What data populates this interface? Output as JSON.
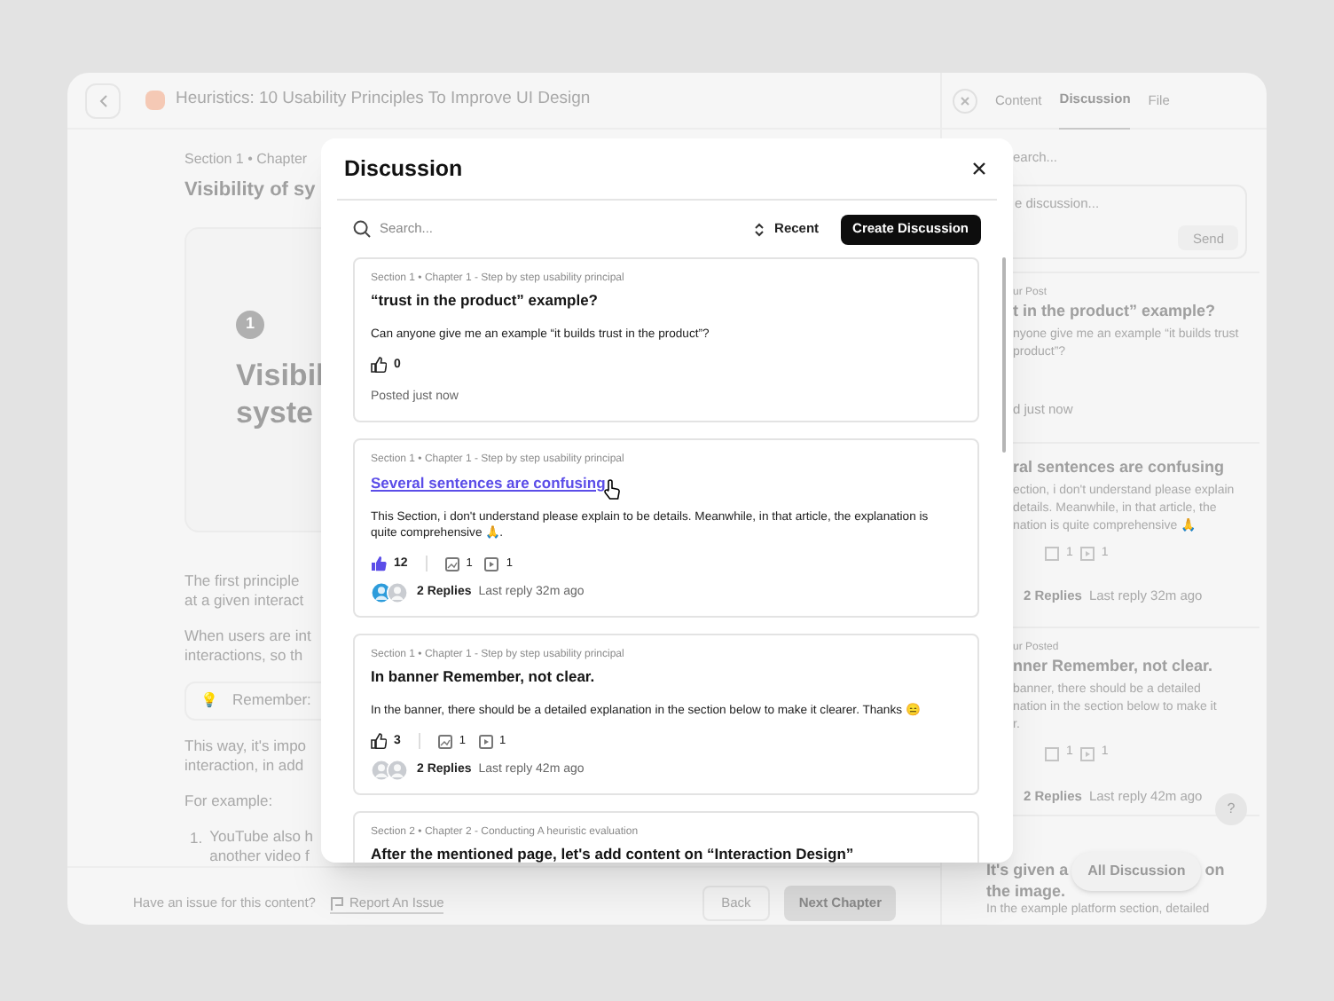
{
  "app": {
    "title": "Heuristics: 10 Usability Principles To Improve UI Design"
  },
  "lesson": {
    "breadcrumb": "Section 1 • Chapter",
    "heading": "Visibility of sy",
    "card_number": "1",
    "card_title_lines": [
      "Visibil",
      "syste"
    ],
    "paragraphs": [
      [
        "The first principle",
        "at a given interact"
      ],
      [
        "When users are int",
        "interactions, so th"
      ]
    ],
    "banner": {
      "emoji": "💡",
      "text": "Remember:"
    },
    "paragraphs_after": [
      [
        "This way, it's impo",
        "interaction, in add"
      ],
      [
        "For example:"
      ]
    ],
    "list": [
      {
        "number": "1.",
        "lines": [
          "YouTube also h",
          "another video f"
        ]
      }
    ]
  },
  "footer": {
    "question": "Have an issue for this content?",
    "report": "Report An Issue",
    "back": "Back",
    "next": "Next Chapter"
  },
  "sidebar": {
    "tabs": [
      {
        "label": "Content",
        "selected": false
      },
      {
        "label": "Discussion",
        "selected": true
      },
      {
        "label": "File",
        "selected": false
      }
    ],
    "search_placeholder": "earch...",
    "compose_placeholder": "e discussion...",
    "send": "Send",
    "posts": [
      {
        "meta": "ur Post",
        "title": "t in the product” example?",
        "body": [
          "nyone give me an example “it builds trust",
          "product”?"
        ],
        "posted": "d just now"
      },
      {
        "title": "ral sentences are confusing",
        "body": [
          "ection, i don't understand please explain",
          "details. Meanwhile, in that article, the",
          "nation is quite comprehensive 🙏"
        ],
        "images": "1",
        "videos": "1",
        "replies": "2 Replies",
        "last_reply": "Last reply 32m ago"
      },
      {
        "meta": "ur Posted",
        "title": "nner Remember, not clear.",
        "body": [
          "banner, there should be a detailed",
          "nation in the section below to make it",
          "r."
        ],
        "images": "1",
        "videos": "1",
        "replies": "2 Replies",
        "last_reply": "Last reply 42m ago"
      }
    ],
    "bottom_title": [
      "It's given a",
      "on",
      "the image."
    ],
    "bottom_text": "In the example platform section, detailed",
    "all_button": "All Discussion",
    "help": "?"
  },
  "modal": {
    "title": "Discussion",
    "search_placeholder": "Search...",
    "sort": "Recent",
    "create": "Create Discussion",
    "threads": [
      {
        "meta": "Section 1 • Chapter 1 - Step by step usability principal",
        "title": "“trust in the product” example?",
        "hovered": false,
        "body": "Can anyone give me an example “it builds trust in the product”?",
        "liked": false,
        "likes": "0",
        "posted": "Posted just now"
      },
      {
        "meta": "Section 1 • Chapter 1 - Step by step usability principal",
        "title": "Several sentences are confusing",
        "hovered": true,
        "body": "This Section, i don't understand please explain to be details. Meanwhile, in that article, the explanation is quite comprehensive 🙏.",
        "liked": true,
        "likes": "12",
        "images": "1",
        "videos": "1",
        "avatars": [
          {
            "kind": "initials",
            "color": "#2d9cdb"
          },
          {
            "kind": "photo"
          }
        ],
        "replies": "2 Replies",
        "last_reply": "Last reply 32m ago"
      },
      {
        "meta": "Section 1 • Chapter 1 - Step by step usability principal",
        "title": "In banner Remember, not clear.",
        "hovered": false,
        "body": "In the banner, there should be a detailed explanation in the section below to make it clearer. Thanks 😑",
        "liked": false,
        "likes": "3",
        "images": "1",
        "videos": "1",
        "avatars": [
          {
            "kind": "photo"
          },
          {
            "kind": "photo"
          }
        ],
        "replies": "2 Replies",
        "last_reply": "Last reply 42m ago"
      },
      {
        "meta": "Section 2 • Chapter 2 - Conducting A heuristic evaluation",
        "title": "After the mentioned page, let's add content on “Interaction Design”",
        "hovered": false
      }
    ]
  }
}
